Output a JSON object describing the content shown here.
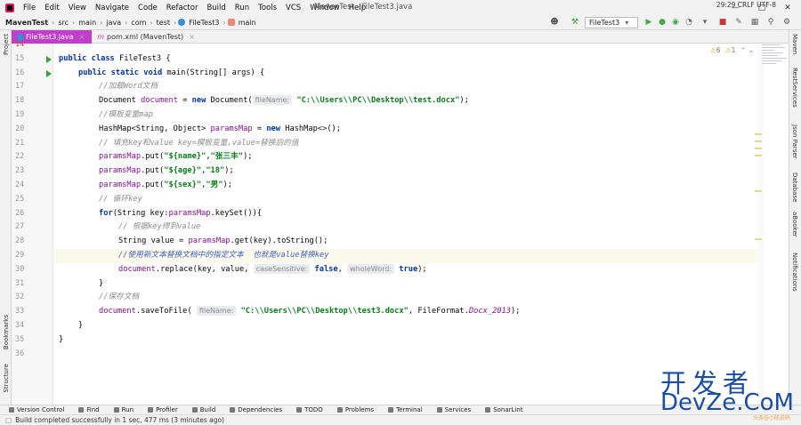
{
  "menubar": {
    "items": [
      "File",
      "Edit",
      "View",
      "Navigate",
      "Code",
      "Refactor",
      "Build",
      "Run",
      "Tools",
      "VCS",
      "Window",
      "Help"
    ],
    "window_title": "MavenTest - FileTest3.java"
  },
  "navbar": {
    "crumbs": [
      "MavenTest",
      "src",
      "main",
      "java",
      "com",
      "test",
      "FileTest3",
      "main"
    ],
    "run_config": "FileTest3"
  },
  "tabs": [
    {
      "label": "FileTest3.java",
      "active": true
    },
    {
      "label": "pom.xml (MavenTest)",
      "active": false
    }
  ],
  "left_tools": [
    "Project",
    "Bookmarks",
    "Structure"
  ],
  "right_tools": [
    "Maven",
    "RestServices",
    "Json Parser",
    "Database",
    "aBooker",
    "Notifications"
  ],
  "inspections": {
    "warnings": "6",
    "weak_warnings": "1"
  },
  "gutter": {
    "lines": [
      "14",
      "15",
      "16",
      "17",
      "18",
      "19",
      "20",
      "21",
      "22",
      "23",
      "24",
      "25",
      "26",
      "27",
      "28",
      "29",
      "30",
      "31",
      "32",
      "33",
      "34",
      "35",
      "36"
    ]
  },
  "code": {
    "l14": "",
    "l15_kw1": "public",
    "l15_kw2": "class",
    "l15_rest": " FileTest3 {",
    "l16_kw1": "public",
    "l16_kw2": "static",
    "l16_kw3": "void",
    "l16_rest": " main(String[] args) {",
    "l17": "//加载Word文档",
    "l18_a": "Document ",
    "l18_var": "document",
    "l18_b": " = ",
    "l18_new": "new",
    "l18_c": " Document(",
    "l18_hint": "fileName:",
    "l18_str": "\"C:\\\\Users\\\\PC\\\\Desktop\\\\test.docx\"",
    "l18_end": ");",
    "l19": "//模板变量map",
    "l20_a": "HashMap<String, Object> ",
    "l20_var": "paramsMap",
    "l20_b": " = ",
    "l20_new": "new",
    "l20_c": " HashMap<>();",
    "l21": "// 填充key和value key=模板变量,value=替换后的值",
    "l22_var": "paramsMap",
    "l22_a": ".put(",
    "l22_s1": "\"${name}\"",
    "l22_b": ",",
    "l22_s2": "\"张三丰\"",
    "l22_c": ");",
    "l23_var": "paramsMap",
    "l23_a": ".put(",
    "l23_s1": "\"${age}\"",
    "l23_b": ",",
    "l23_s2": "\"18\"",
    "l23_c": ");",
    "l24_var": "paramsMap",
    "l24_a": ".put(",
    "l24_s1": "\"${sex}\"",
    "l24_b": ",",
    "l24_s2": "\"男\"",
    "l24_c": ");",
    "l25": "// 循环key",
    "l26_for": "for",
    "l26_a": "(String key:",
    "l26_var": "paramsMap",
    "l26_b": ".keySet()){",
    "l27": "// 根据key得到value",
    "l28_a": "String value = ",
    "l28_var": "paramsMap",
    "l28_b": ".get(key).toString();",
    "l29": "//使用新文本替换文档中的指定文本  也就是value替换key",
    "l30_var": "document",
    "l30_a": ".replace(key, value, ",
    "l30_h1": "caseSensitive:",
    "l30_f1": "false",
    "l30_b": ", ",
    "l30_h2": "wholeWord:",
    "l30_t": "true",
    "l30_c": ");",
    "l31": "}",
    "l32": "//保存文档",
    "l33_var": "document",
    "l33_a": ".saveToFile( ",
    "l33_hint": "fileName:",
    "l33_str": "\"C:\\\\Users\\\\PC\\\\Desktop\\\\test3.docx\"",
    "l33_b": ", FileFormat.",
    "l33_it": "Docx_2013",
    "l33_c": ");",
    "l34": "}",
    "l35": "}",
    "l36": ""
  },
  "bottom_tools": [
    "Version Control",
    "Find",
    "Run",
    "Profiler",
    "Build",
    "Dependencies",
    "TODO",
    "Problems",
    "Terminal",
    "Services",
    "SonarLint"
  ],
  "status": {
    "message": "Build completed successfully in 1 sec, 477 ms (3 minutes ago)",
    "right": "29:29  CRLF  UTF-8"
  },
  "watermark": {
    "line1": "开发者",
    "line2": "DevZe.CoM",
    "line3": "头条@小陈说码"
  },
  "colors": {
    "active_tab": "#c13ecb",
    "keyword": "#0033b3",
    "string": "#067d17",
    "comment": "#8c8c8c",
    "field": "#871094",
    "watermark": "#1b4ea1"
  }
}
